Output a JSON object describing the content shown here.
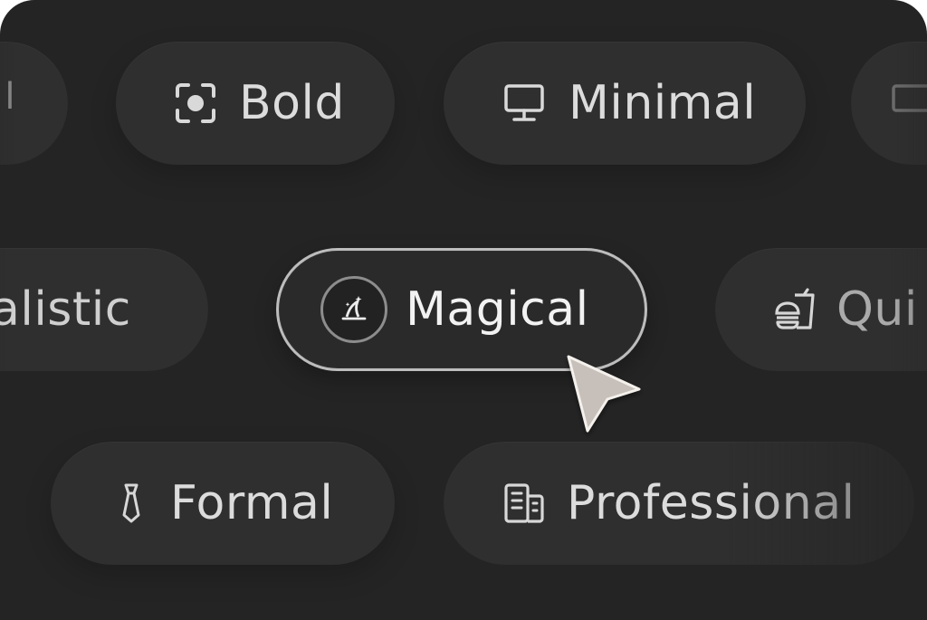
{
  "pills": {
    "partial_left_top": {
      "label": "l",
      "icon": "partial-pill-icon"
    },
    "bold": {
      "label": "Bold",
      "icon": "focus-frame-icon"
    },
    "minimal": {
      "label": "Minimal",
      "icon": "monitor-icon"
    },
    "partial_right_top": {
      "label": "",
      "icon": "monitor-icon"
    },
    "realistic": {
      "label": "alistic",
      "icon": ""
    },
    "magical": {
      "label": "Magical",
      "icon": "wizard-hat-icon",
      "selected": true
    },
    "quirky": {
      "label": "Qui",
      "icon": "burger-drink-icon"
    },
    "formal": {
      "label": "Formal",
      "icon": "tie-icon"
    },
    "professional": {
      "label": "Professional",
      "icon": "building-icon"
    }
  },
  "colors": {
    "background": "#242424",
    "pill": "#2f2f2f",
    "selected_border": "#bdbdbd",
    "text": "#dcdcdc",
    "cursor": "#c9c3bd"
  }
}
